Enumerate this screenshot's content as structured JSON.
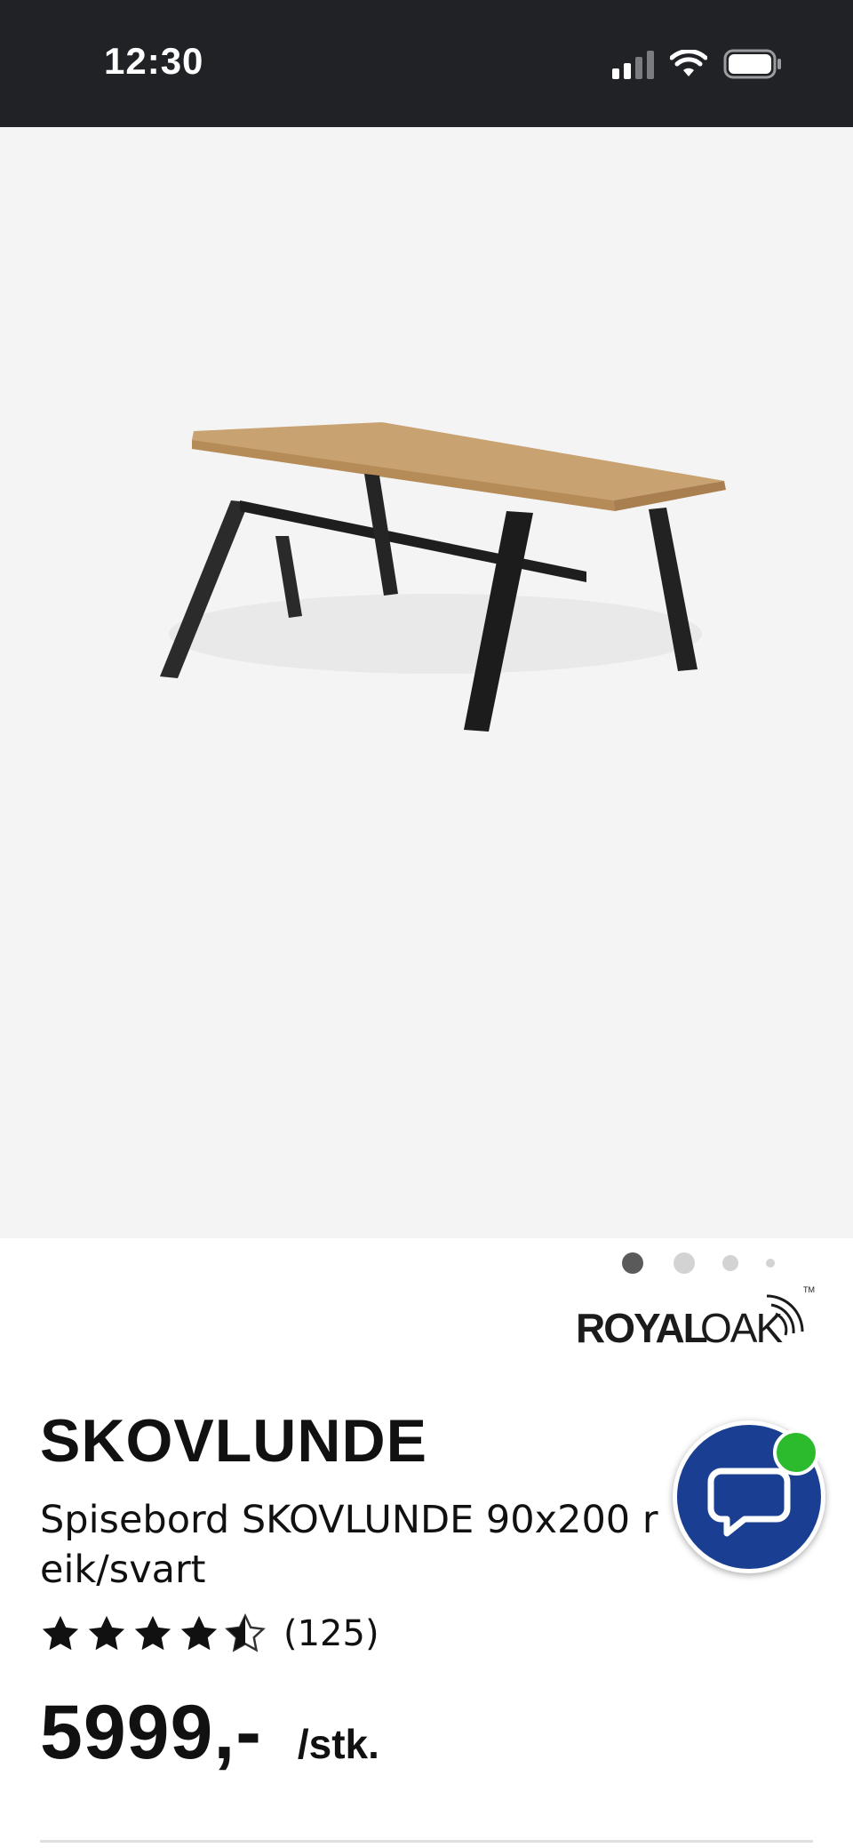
{
  "status_bar": {
    "time": "12:30",
    "icons": [
      "signal-icon",
      "wifi-icon",
      "battery-icon"
    ]
  },
  "gallery": {
    "image_label": "dining-table-product-image",
    "page_count": 4,
    "active_index": 0
  },
  "brand": {
    "logo_text_bold": "ROYAL",
    "logo_text_light": "OAK",
    "logo_mark": "TM"
  },
  "product": {
    "name": "SKOVLUNDE",
    "description": "Spisebord SKOVLUNDE 90x200 r eik/svart",
    "rating": 4.5,
    "rating_max": 5,
    "review_count": "(125)",
    "price": "5999,-",
    "unit": "/stk."
  },
  "chat": {
    "icon": "chat-bubble-icon",
    "status": "online"
  },
  "colors": {
    "status_bar_bg": "#202226",
    "gallery_bg": "#f4f4f4",
    "chat_bg": "#1a3f92",
    "online_badge": "#2dbb2e"
  }
}
